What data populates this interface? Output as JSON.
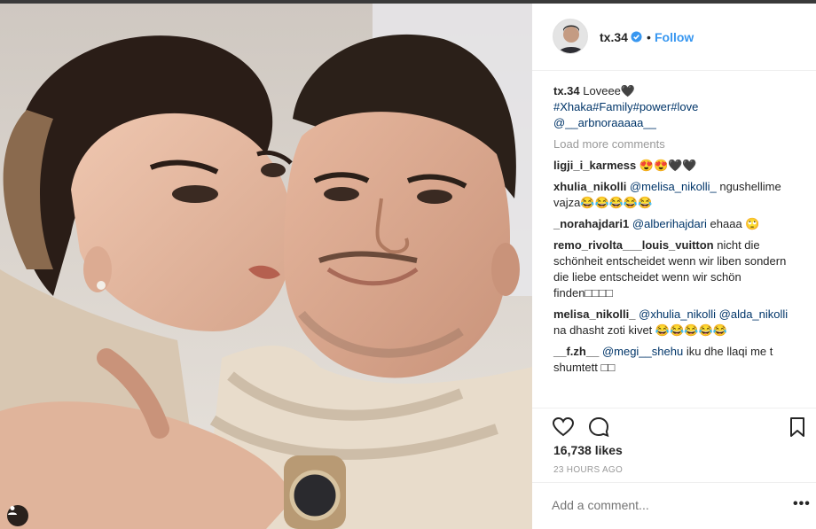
{
  "post": {
    "author": "tx.34",
    "follow_label": "Follow",
    "separator": "•",
    "caption": {
      "username": "tx.34",
      "text": " Loveee🖤",
      "hashtags": "#Xhaka#Family#power#love",
      "mention": "@__arbnoraaaaa__"
    },
    "load_more": "Load more comments",
    "comments": [
      {
        "user": "ligji_i_karmess",
        "parts": [
          {
            "t": " 😍😍🖤🖤",
            "m": false
          }
        ]
      },
      {
        "user": "xhulia_nikolli",
        "parts": [
          {
            "t": " ",
            "m": false
          },
          {
            "t": "@melisa_nikolli_",
            "m": true
          },
          {
            "t": " ngushellime vajza😂😂😂😂😂",
            "m": false
          }
        ]
      },
      {
        "user": "_norahajdari1",
        "parts": [
          {
            "t": " ",
            "m": false
          },
          {
            "t": "@alberihajdari",
            "m": true
          },
          {
            "t": " ehaaa 🙄",
            "m": false
          }
        ]
      },
      {
        "user": "remo_rivolta___louis_vuitton",
        "parts": [
          {
            "t": " nicht die schönheit entscheidet wenn wir liben sondern die liebe entscheidet wenn wir schön finden□□□□",
            "m": false
          }
        ]
      },
      {
        "user": "melisa_nikolli_",
        "parts": [
          {
            "t": " ",
            "m": false
          },
          {
            "t": "@xhulia_nikolli",
            "m": true
          },
          {
            "t": " ",
            "m": false
          },
          {
            "t": "@alda_nikolli",
            "m": true
          },
          {
            "t": " na dhasht zoti kivet 😂😂😂😂😂",
            "m": false
          }
        ]
      },
      {
        "user": "__f.zh__",
        "parts": [
          {
            "t": " ",
            "m": false
          },
          {
            "t": "@megi__shehu",
            "m": true
          },
          {
            "t": " iku dhe llaqi me t shumtett □□",
            "m": false
          }
        ]
      }
    ],
    "likes": "16,738 likes",
    "time": "23 HOURS AGO",
    "add_comment_placeholder": "Add a comment...",
    "more_label": "•••"
  },
  "icons": {
    "heart": "heart-icon",
    "comment": "comment-icon",
    "bookmark": "bookmark-icon",
    "verified": "verified-badge-icon",
    "tag": "user-tag-icon"
  },
  "colors": {
    "link": "#3897f0",
    "mention": "#003569",
    "muted": "#999999",
    "text": "#262626"
  }
}
